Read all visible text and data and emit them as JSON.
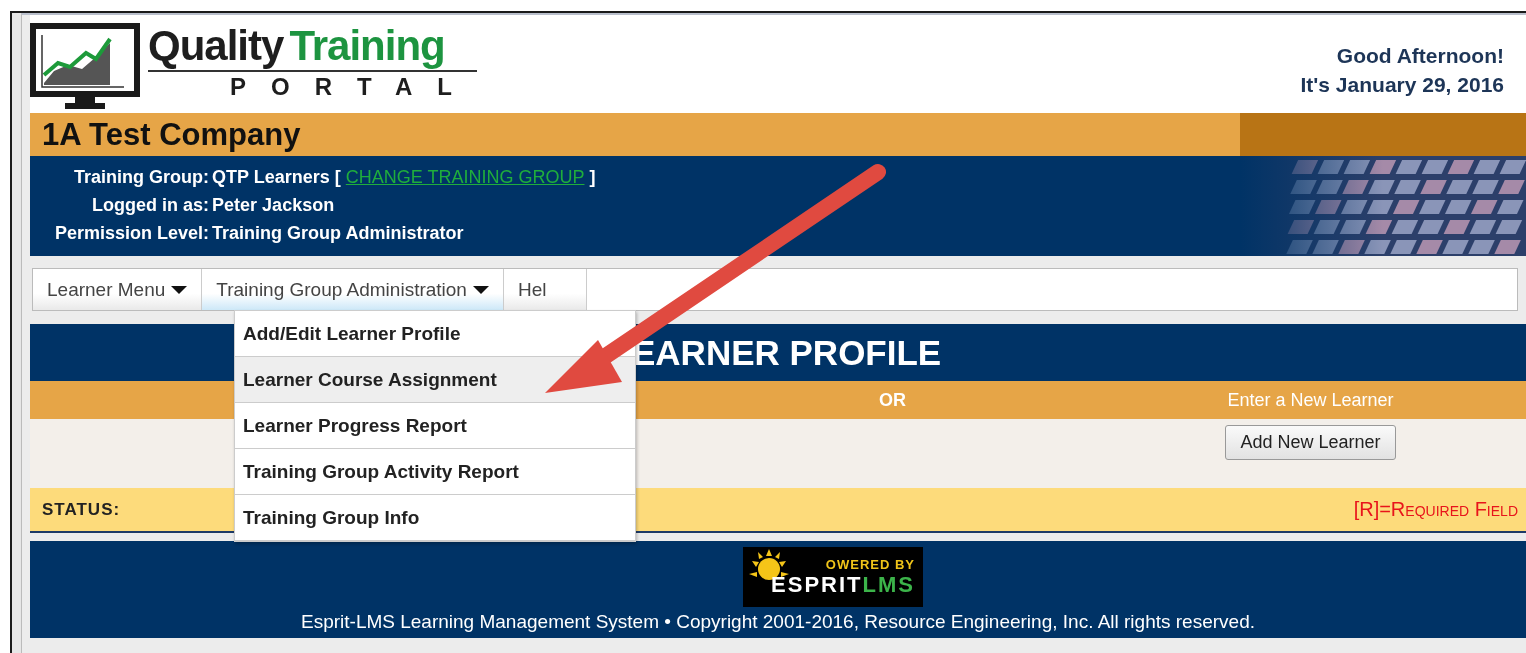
{
  "header": {
    "logo": {
      "word_1": "Quality",
      "word_2": "Training",
      "subtitle": "PORTAL"
    },
    "greeting": "Good Afternoon!",
    "date": "It's January 29, 2016"
  },
  "company": "1A Test Company",
  "info": [
    {
      "label": "Training Group:",
      "value": "QTP Learners [",
      "link": "CHANGE TRAINING GROUP",
      "after": "]"
    },
    {
      "label": "Logged in as:",
      "value": "Peter Jackson"
    },
    {
      "label": "Permission Level:",
      "value": "Training Group Administrator"
    }
  ],
  "nav": [
    {
      "label": "Learner Menu",
      "has_menu": true,
      "selected": false
    },
    {
      "label": "Training Group Administration",
      "has_menu": true,
      "selected": true
    },
    {
      "label": "Hel",
      "has_menu": false,
      "selected": false
    }
  ],
  "dropdown": [
    {
      "label": "Add/Edit Learner Profile",
      "selected": false
    },
    {
      "label": "Learner Course Assignment",
      "selected": true
    },
    {
      "label": "Learner Progress Report",
      "selected": false
    },
    {
      "label": "Training Group Activity Report",
      "selected": false
    },
    {
      "label": "Training Group Info",
      "selected": false
    }
  ],
  "page_title": "EARNER PROFILE",
  "columns": [
    "OR",
    "Enter a New Learner"
  ],
  "add_button": "Add New Learner",
  "status": {
    "label": "STATUS:",
    "required_note": "[R]=Required Field"
  },
  "footer": {
    "badge": {
      "line_1": "OWERED BY",
      "line_2a": "ESPRIT",
      "line_2b": "LMS"
    },
    "copyright": "Esprit-LMS Learning Management System • Copyright 2001-2016, Resource Engineering, Inc. All rights reserved."
  }
}
